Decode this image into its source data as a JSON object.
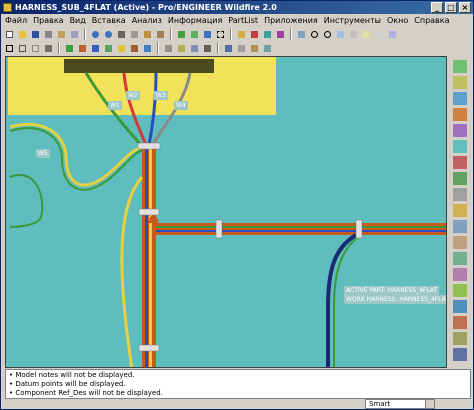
{
  "window": {
    "title": "HARNESS_SUB_4FLAT (Active) - Pro/ENGINEER Wildfire 2.0",
    "controls": [
      "_",
      "□",
      "×"
    ]
  },
  "menu": [
    "Файл",
    "Правка",
    "Вид",
    "Вставка",
    "Анализ",
    "Информация",
    "PartList",
    "Приложения",
    "Инструменты",
    "Окно",
    "Справка"
  ],
  "viewport": {
    "background": "#5fbdbd",
    "connector_color": "#f2e25a",
    "wire_labels": [
      "W1",
      "W2",
      "W3",
      "W4",
      "W5"
    ],
    "info_lines": [
      "ACTIVE PART: HARNESS_4FLAT",
      "WORK HARNESS: HARNESS_4FLAT"
    ]
  },
  "messages": [
    "• Model notes will not be displayed.",
    "• Datum points will be displayed.",
    "• Component Ref_Des will not be displayed."
  ],
  "status": {
    "filter_value": "Smart"
  }
}
